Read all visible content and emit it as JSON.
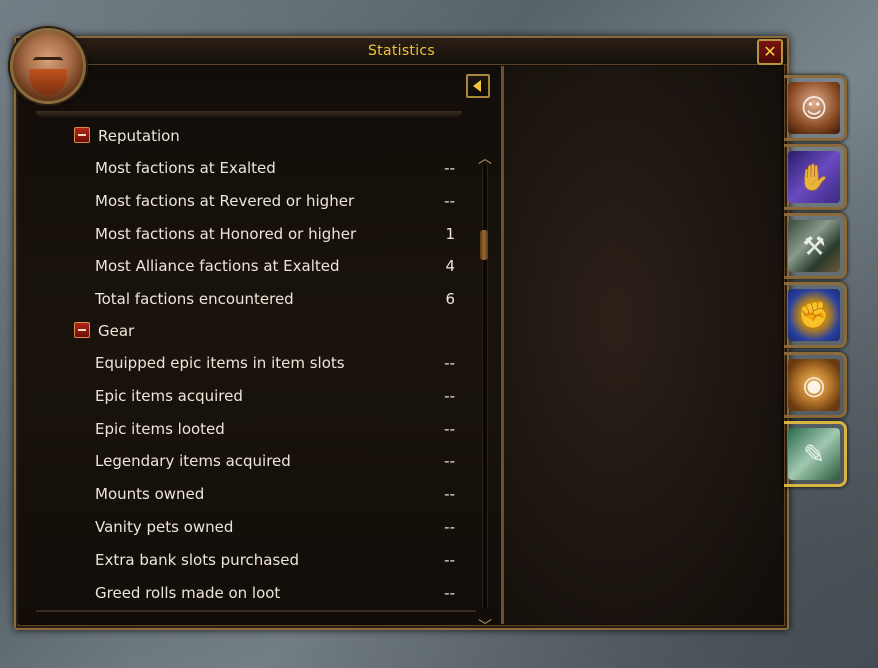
{
  "window": {
    "title": "Statistics",
    "close_glyph": "✕"
  },
  "categories": [
    {
      "name": "Reputation",
      "expanded": true,
      "rows": [
        {
          "label": "Most factions at Exalted",
          "value": "--"
        },
        {
          "label": "Most factions at Revered or higher",
          "value": "--"
        },
        {
          "label": "Most factions at Honored or higher",
          "value": "1"
        },
        {
          "label": "Most Alliance factions at Exalted",
          "value": "4"
        },
        {
          "label": "Total factions encountered",
          "value": "6"
        }
      ]
    },
    {
      "name": "Gear",
      "expanded": true,
      "rows": [
        {
          "label": "Equipped epic items in item slots",
          "value": "--"
        },
        {
          "label": "Epic items acquired",
          "value": "--"
        },
        {
          "label": "Epic items looted",
          "value": "--"
        },
        {
          "label": "Legendary items acquired",
          "value": "--"
        },
        {
          "label": "Mounts owned",
          "value": "--"
        },
        {
          "label": "Vanity pets owned",
          "value": "--"
        },
        {
          "label": "Extra bank slots purchased",
          "value": "--"
        },
        {
          "label": "Greed rolls made on loot",
          "value": "--"
        }
      ]
    }
  ],
  "side_tabs": [
    {
      "icon": "character-portrait-icon",
      "active": false
    },
    {
      "icon": "handshake-icon",
      "active": false
    },
    {
      "icon": "mining-pick-icon",
      "active": false
    },
    {
      "icon": "guild-fist-icon",
      "active": false
    },
    {
      "icon": "gold-coins-icon",
      "active": false
    },
    {
      "icon": "scroll-icon",
      "active": true
    }
  ],
  "colors": {
    "title": "#f2c230",
    "text": "#ece6d8",
    "border": "#8a6a3a"
  }
}
